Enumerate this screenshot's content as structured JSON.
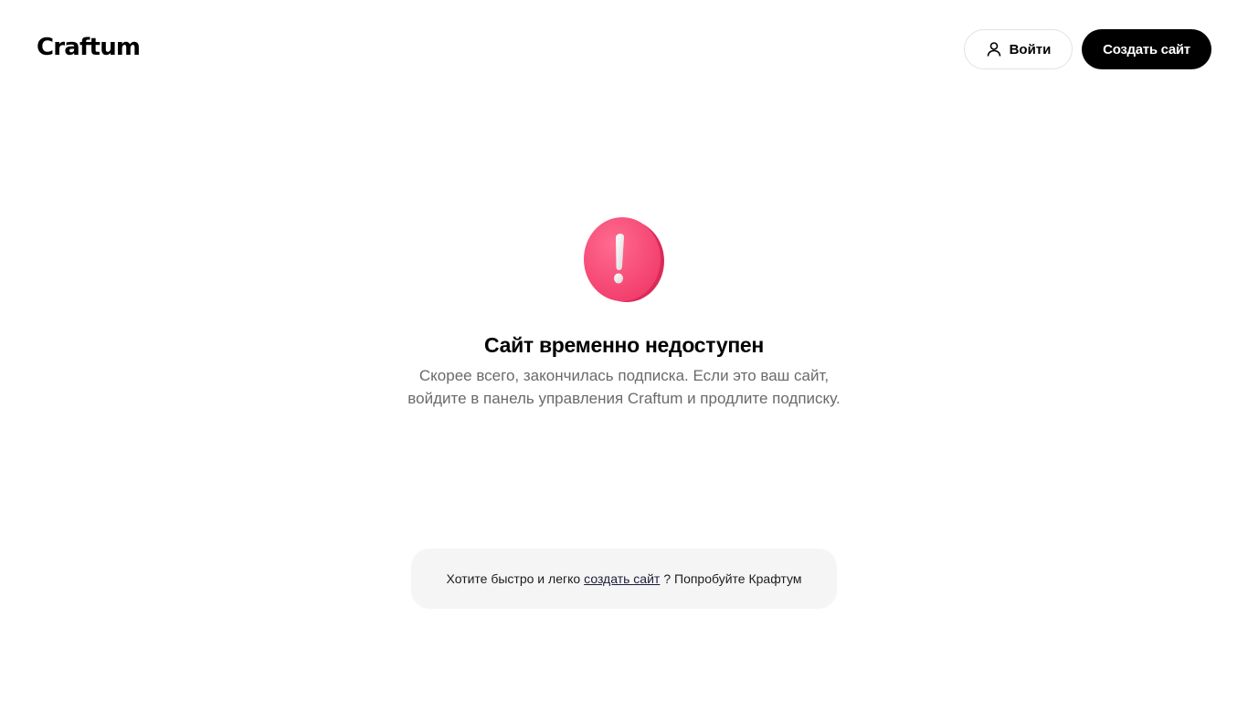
{
  "header": {
    "logo": "Craftum",
    "login_label": "Войти",
    "create_label": "Создать сайт"
  },
  "main": {
    "icon": "exclamation-alert-icon",
    "title": "Сайт временно недоступен",
    "subtitle_line1": "Скорее всего, закончилась подписка. Если это ваш сайт,",
    "subtitle_line2": "войдите в панель управления Craftum и продлите подписку."
  },
  "promo": {
    "text_before": "Хотите быстро и легко",
    "link_label": "создать сайт",
    "text_after": "? Попробуйте Крафтум"
  },
  "colors": {
    "accent": "#ff4d7a",
    "button_dark": "#000000",
    "promo_bg": "#f5f5f5",
    "subtitle": "#6a6a6a"
  }
}
